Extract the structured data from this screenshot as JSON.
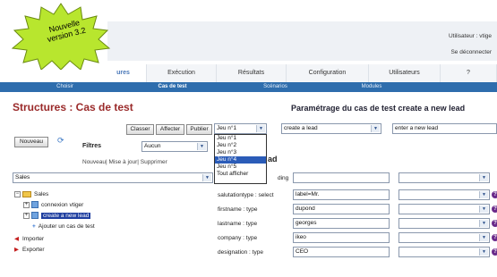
{
  "badge": {
    "line1": "Nouvelle",
    "line2": "version 3.2"
  },
  "user": {
    "label": "Utilisateur : vtige",
    "logout": "Se déconnecter"
  },
  "main_tabs": [
    {
      "label": "ures",
      "active": true
    },
    {
      "label": "Exécution",
      "active": false
    },
    {
      "label": "Résultats",
      "active": false
    },
    {
      "label": "Configuration",
      "active": false
    },
    {
      "label": "Utilisateurs",
      "active": false
    },
    {
      "label": "?",
      "active": false
    }
  ],
  "sub_tabs": [
    {
      "label": "Choisir"
    },
    {
      "label": "Cas de test"
    },
    {
      "label": "Scénarios"
    },
    {
      "label": "Modules"
    }
  ],
  "page_title": "Structures : Cas de test",
  "param_title": "Paramétrage du cas de test create a new lead",
  "toolbar": {
    "classer": "Classer",
    "affecter": "Affecter",
    "publier": "Publier"
  },
  "jeu_select": {
    "value": "Jeu n°1"
  },
  "action_select": {
    "value": "create a lead"
  },
  "step_select": {
    "value": "enter a new lead"
  },
  "dropdown_options": [
    "Jeu n°1",
    "Jeu n°2",
    "Jeu n°3",
    "Jeu n°4",
    "Jeu n°5",
    "Tout afficher"
  ],
  "dropdown_selected_index": 3,
  "nouveau_button": "Nouveau",
  "filters": {
    "label": "Filtres",
    "value": "Aucun",
    "links": "Nouveau| Mise à jour| Supprimer"
  },
  "module_select": {
    "value": "Sales"
  },
  "lead_header": "ad",
  "tree": {
    "root": "Sales",
    "children": [
      "connexion vtiger",
      "create a new lead",
      "Ajouter un cas de test"
    ],
    "actions": [
      "Importer",
      "Exporter"
    ]
  },
  "form_rows": [
    {
      "label": "ding",
      "value": ""
    },
    {
      "label": "salutationtype : select",
      "value": "label=Mr."
    },
    {
      "label": "firstname : type",
      "value": "dupond"
    },
    {
      "label": "lastname : type",
      "value": "georges"
    },
    {
      "label": "company : type",
      "value": "ikeo"
    },
    {
      "label": "designation : type",
      "value": "CEO"
    }
  ],
  "colors": {
    "accent": "#2e6dad",
    "title": "#9a2a2a",
    "badge": "#b8e62e",
    "selection": "#2b5cb8"
  }
}
